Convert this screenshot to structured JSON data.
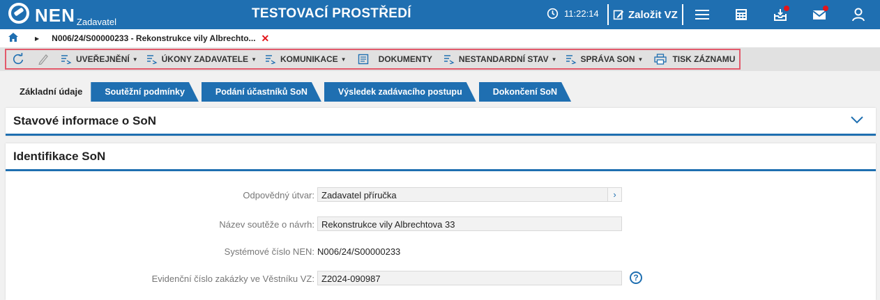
{
  "header": {
    "logo_text": "NEN",
    "logo_sub": "Zadavatel",
    "env_title": "TESTOVACÍ PROSTŘEDÍ",
    "time": "11:22:14",
    "create_label": "Založit VZ",
    "icons": [
      "clock-icon",
      "edit-icon",
      "menu-icon",
      "calculator-icon",
      "inbox-icon",
      "mail-icon",
      "user-icon"
    ],
    "color_primary": "#1f6fb1",
    "color_badge": "#e3151a"
  },
  "breadcrumb": {
    "title": "N006/24/S00000233 - Rekonstrukce vily Albrechto...",
    "close": "✕"
  },
  "toolbar": {
    "items": [
      {
        "label": "UVEŘEJNĚNÍ"
      },
      {
        "label": "ÚKONY ZADAVATELE"
      },
      {
        "label": "KOMUNIKACE"
      },
      {
        "label": "DOKUMENTY"
      },
      {
        "label": "NESTANDARDNÍ STAV"
      },
      {
        "label": "SPRÁVA SON"
      },
      {
        "label": "TISK ZÁZNAMU"
      }
    ]
  },
  "tabs": [
    {
      "label": "Základní údaje"
    },
    {
      "label": "Soutěžní podmínky"
    },
    {
      "label": "Podání účastníků SoN"
    },
    {
      "label": "Výsledek zadávacího postupu"
    },
    {
      "label": "Dokončení SoN"
    }
  ],
  "panels": {
    "status_title": "Stavové informace o SoN",
    "ident_title": "Identifikace SoN"
  },
  "form": {
    "unit_label": "Odpovědný útvar:",
    "unit_value": "Zadavatel příručka",
    "name_label": "Název soutěže o návrh:",
    "name_value": "Rekonstrukce vily Albrechtova 33",
    "sysnum_label": "Systémové číslo NEN:",
    "sysnum_value": "N006/24/S00000233",
    "evnum_label": "Evidenční číslo zakázky ve Věstníku VZ:",
    "evnum_value": "Z2024-090987",
    "help_mark": "?",
    "go_mark": "›"
  }
}
